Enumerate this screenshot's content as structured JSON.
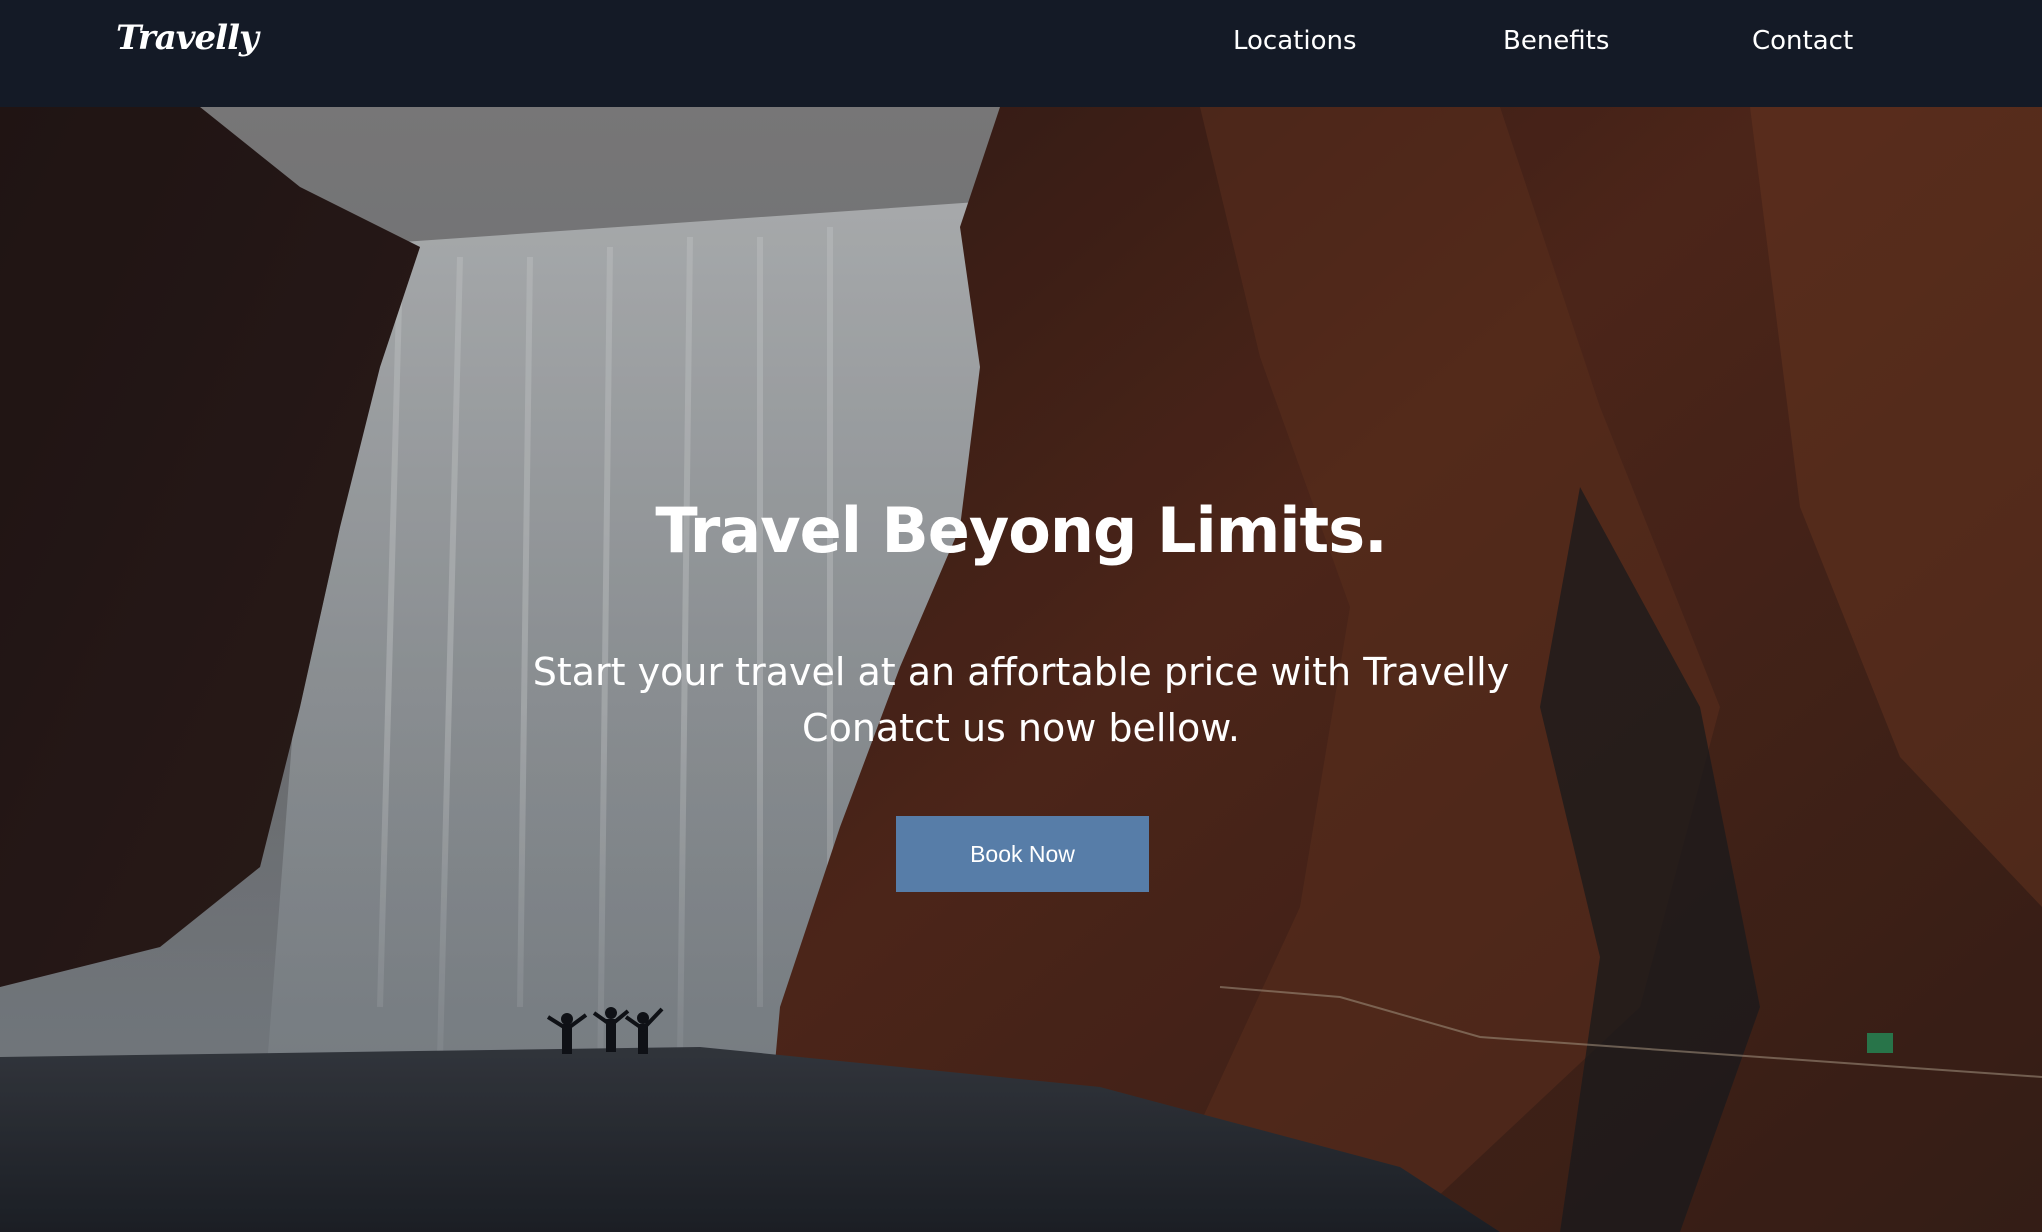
{
  "brand": {
    "name": "Travelly"
  },
  "nav": {
    "links": [
      {
        "label": "Locations"
      },
      {
        "label": "Benefits"
      },
      {
        "label": "Contact"
      }
    ]
  },
  "hero": {
    "title": "Travel Beyong Limits.",
    "subtitle_line1": "Start your travel at an affortable price with Travelly",
    "subtitle_line2": "Conatct us now bellow.",
    "cta_label": "Book Now"
  },
  "colors": {
    "nav_background": "#141a26",
    "button_background": "#577da8",
    "text": "#ffffff"
  }
}
